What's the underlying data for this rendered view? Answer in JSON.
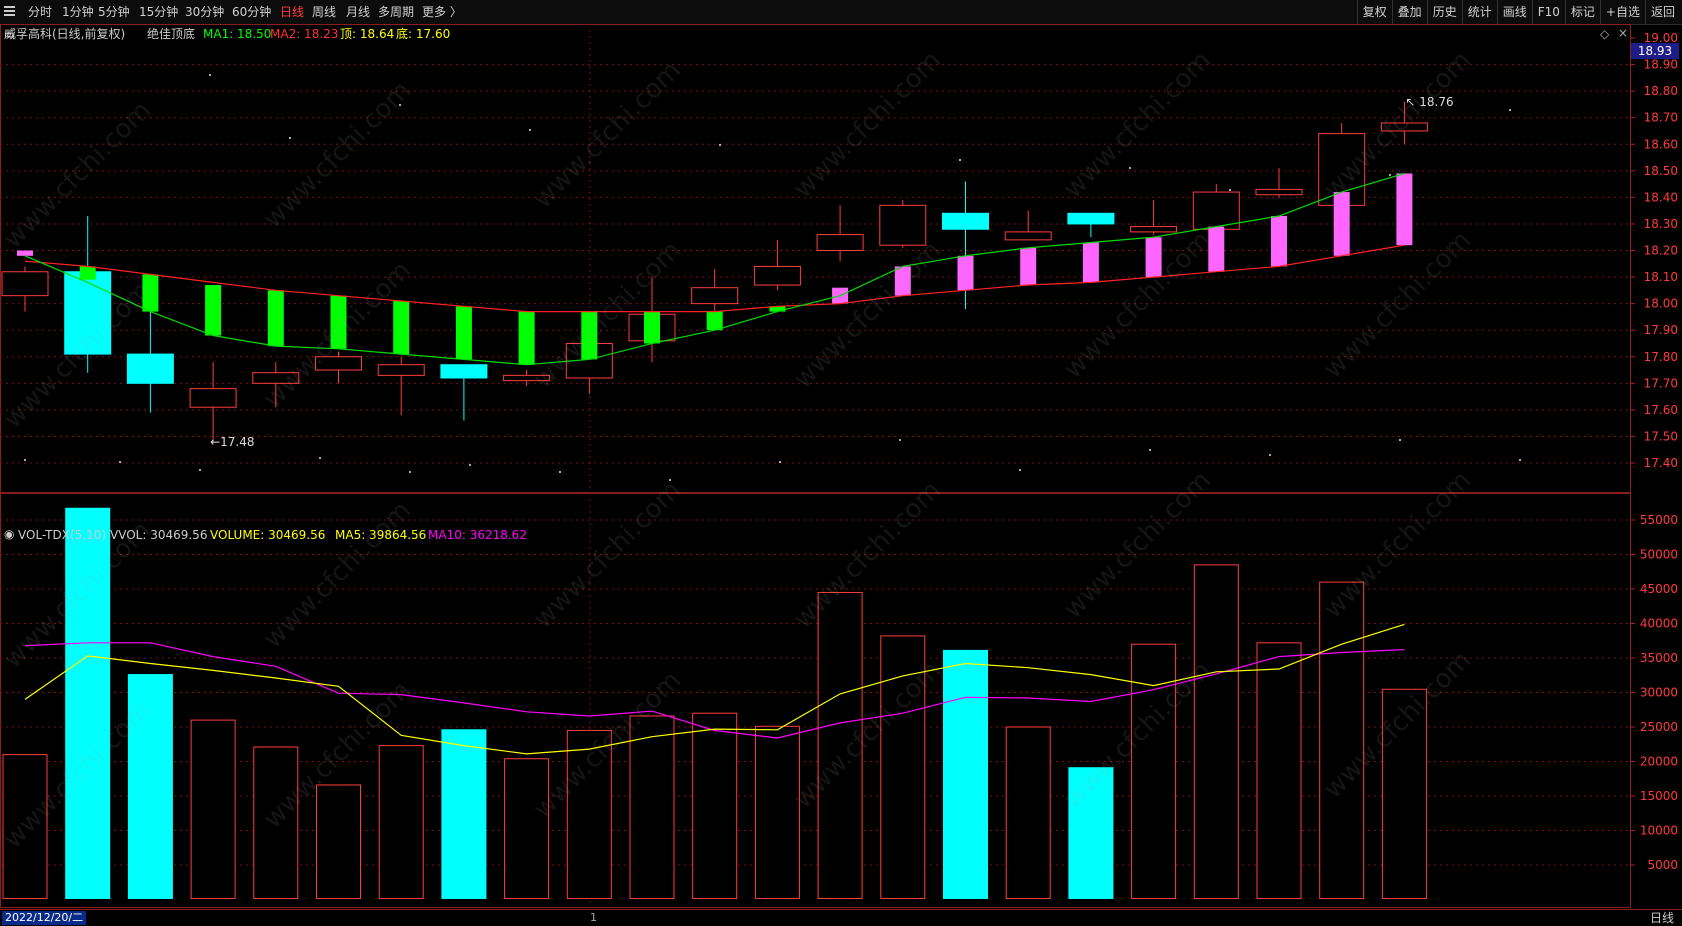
{
  "toolbar": {
    "periods": [
      "分时",
      "1分钟",
      "5分钟",
      "15分钟",
      "30分钟",
      "60分钟",
      "日线",
      "周线",
      "月线",
      "多周期",
      "更多 〉"
    ],
    "active_period": "日线",
    "right_buttons": [
      "复权",
      "叠加",
      "历史",
      "统计",
      "画线",
      "F10",
      "标记",
      "+自选",
      "返回"
    ]
  },
  "main_overlay": {
    "stock_name": "威孚高科(日线,前复权)",
    "indicator": "绝佳顶底",
    "ma1_label": "MA1: 18.50",
    "ma2_label": "MA2: 18.23",
    "top_label": "顶: 18.64",
    "bottom_label": "底: 17.60"
  },
  "vol_overlay": {
    "indicator": "VOL-TDX(5,10)",
    "vvol_label": "VVOL: 30469.56",
    "volume_label": "VOLUME: 30469.56",
    "ma5_label": "MA5: 39864.56",
    "ma10_label": "MA10: 36218.62"
  },
  "current_price_tag": "18.93",
  "high_annotation": "18.76",
  "low_annotation": "17.48",
  "bottom_bar": {
    "date": "2022/12/20/二",
    "mid_marker": "1",
    "period": "日线"
  },
  "watermark_text": "www.cfchi.com",
  "colors": {
    "up": "#ff3c3c",
    "up_fill_magenta": "#ff66ff",
    "down_cyan": "#00ffff",
    "down_green": "#00ff00",
    "ma_green": "#00dd00",
    "ma_red": "#ff2222",
    "vol_ma5": "#ffff00",
    "vol_ma10": "#ff00ff"
  },
  "chart_data": [
    {
      "type": "candlestick",
      "price_ticks": [
        "19.00",
        "18.90",
        "18.80",
        "18.70",
        "18.60",
        "18.50",
        "18.40",
        "18.30",
        "18.20",
        "18.10",
        "18.00",
        "17.90",
        "17.80",
        "17.70",
        "17.60",
        "17.50",
        "17.40"
      ],
      "ylim": [
        17.34,
        19.02
      ],
      "candles": [
        {
          "o": 18.03,
          "h": 18.14,
          "l": 17.97,
          "c": 18.12,
          "style": "up"
        },
        {
          "o": 18.12,
          "h": 18.33,
          "l": 17.74,
          "c": 17.81,
          "style": "cyan"
        },
        {
          "o": 17.81,
          "h": 17.98,
          "l": 17.59,
          "c": 17.7,
          "style": "cyan"
        },
        {
          "o": 17.61,
          "h": 17.78,
          "l": 17.48,
          "c": 17.68,
          "style": "up"
        },
        {
          "o": 17.7,
          "h": 17.78,
          "l": 17.61,
          "c": 17.74,
          "style": "up"
        },
        {
          "o": 17.75,
          "h": 17.82,
          "l": 17.7,
          "c": 17.8,
          "style": "up"
        },
        {
          "o": 17.73,
          "h": 17.8,
          "l": 17.58,
          "c": 17.77,
          "style": "up"
        },
        {
          "o": 17.77,
          "h": 17.77,
          "l": 17.56,
          "c": 17.72,
          "style": "cyan"
        },
        {
          "o": 17.71,
          "h": 17.75,
          "l": 17.69,
          "c": 17.73,
          "style": "up"
        },
        {
          "o": 17.72,
          "h": 17.79,
          "l": 17.66,
          "c": 17.85,
          "style": "up"
        },
        {
          "o": 17.86,
          "h": 18.1,
          "l": 17.78,
          "c": 17.96,
          "style": "up"
        },
        {
          "o": 18.0,
          "h": 18.13,
          "l": 17.97,
          "c": 18.06,
          "style": "up"
        },
        {
          "o": 18.07,
          "h": 18.24,
          "l": 18.05,
          "c": 18.14,
          "style": "up"
        },
        {
          "o": 18.2,
          "h": 18.37,
          "l": 18.16,
          "c": 18.26,
          "style": "up"
        },
        {
          "o": 18.22,
          "h": 18.39,
          "l": 18.21,
          "c": 18.37,
          "style": "up"
        },
        {
          "o": 18.34,
          "h": 18.46,
          "l": 17.98,
          "c": 18.28,
          "style": "cyan"
        },
        {
          "o": 18.24,
          "h": 18.35,
          "l": 18.24,
          "c": 18.27,
          "style": "up"
        },
        {
          "o": 18.34,
          "h": 18.34,
          "l": 18.25,
          "c": 18.3,
          "style": "cyan"
        },
        {
          "o": 18.27,
          "h": 18.39,
          "l": 18.26,
          "c": 18.29,
          "style": "up"
        },
        {
          "o": 18.28,
          "h": 18.45,
          "l": 18.28,
          "c": 18.42,
          "style": "up"
        },
        {
          "o": 18.41,
          "h": 18.51,
          "l": 18.4,
          "c": 18.43,
          "style": "up"
        },
        {
          "o": 18.37,
          "h": 18.68,
          "l": 18.36,
          "c": 18.64,
          "style": "up"
        },
        {
          "o": 18.65,
          "h": 18.76,
          "l": 18.6,
          "c": 18.68,
          "style": "up"
        }
      ],
      "signal_bars": [
        {
          "i": 0,
          "top": 18.2,
          "bot": 18.18,
          "color": "magenta"
        },
        {
          "i": 1,
          "top": 18.14,
          "bot": 18.09,
          "color": "green"
        },
        {
          "i": 2,
          "top": 18.11,
          "bot": 17.97,
          "color": "green"
        },
        {
          "i": 3,
          "top": 18.07,
          "bot": 17.88,
          "color": "green"
        },
        {
          "i": 4,
          "top": 18.05,
          "bot": 17.84,
          "color": "green"
        },
        {
          "i": 5,
          "top": 18.03,
          "bot": 17.83,
          "color": "green"
        },
        {
          "i": 6,
          "top": 18.01,
          "bot": 17.81,
          "color": "green"
        },
        {
          "i": 7,
          "top": 17.99,
          "bot": 17.79,
          "color": "green"
        },
        {
          "i": 8,
          "top": 17.97,
          "bot": 17.77,
          "color": "green"
        },
        {
          "i": 9,
          "top": 17.97,
          "bot": 17.79,
          "color": "green"
        },
        {
          "i": 10,
          "top": 17.97,
          "bot": 17.85,
          "color": "green"
        },
        {
          "i": 11,
          "top": 17.97,
          "bot": 17.9,
          "color": "green"
        },
        {
          "i": 12,
          "top": 17.99,
          "bot": 17.97,
          "color": "green"
        },
        {
          "i": 13,
          "top": 18.06,
          "bot": 18.0,
          "color": "magenta"
        },
        {
          "i": 14,
          "top": 18.14,
          "bot": 18.03,
          "color": "magenta"
        },
        {
          "i": 15,
          "top": 18.18,
          "bot": 18.05,
          "color": "magenta"
        },
        {
          "i": 16,
          "top": 18.21,
          "bot": 18.07,
          "color": "magenta"
        },
        {
          "i": 17,
          "top": 18.23,
          "bot": 18.08,
          "color": "magenta"
        },
        {
          "i": 18,
          "top": 18.25,
          "bot": 18.1,
          "color": "magenta"
        },
        {
          "i": 19,
          "top": 18.29,
          "bot": 18.12,
          "color": "magenta"
        },
        {
          "i": 20,
          "top": 18.33,
          "bot": 18.14,
          "color": "magenta"
        },
        {
          "i": 21,
          "top": 18.42,
          "bot": 18.18,
          "color": "magenta"
        },
        {
          "i": 22,
          "top": 18.49,
          "bot": 18.22,
          "color": "magenta"
        }
      ],
      "ma1": [
        18.18,
        18.08,
        17.97,
        17.88,
        17.84,
        17.83,
        17.81,
        17.79,
        17.77,
        17.79,
        17.85,
        17.9,
        17.97,
        18.03,
        18.14,
        18.18,
        18.21,
        18.23,
        18.25,
        18.29,
        18.33,
        18.42,
        18.49
      ],
      "ma2": [
        18.16,
        18.14,
        18.11,
        18.08,
        18.05,
        18.03,
        18.01,
        17.99,
        17.97,
        17.97,
        17.97,
        17.97,
        17.99,
        18.0,
        18.03,
        18.05,
        18.07,
        18.08,
        18.1,
        18.12,
        18.14,
        18.18,
        18.22
      ]
    },
    {
      "type": "bar",
      "vol_ticks": [
        "55000",
        "50000",
        "45000",
        "40000",
        "35000",
        "30000",
        "25000",
        "20000",
        "15000",
        "10000",
        "5000"
      ],
      "ylim": [
        0,
        57000
      ],
      "volumes": [
        21000,
        56700,
        32600,
        26000,
        22100,
        16600,
        22300,
        24600,
        20400,
        24500,
        26600,
        27000,
        25100,
        44500,
        38200,
        36100,
        25000,
        19100,
        37000,
        48500,
        37200,
        46000,
        30469.56
      ],
      "vol_styles": [
        "up",
        "cyan",
        "cyan",
        "up",
        "up",
        "up",
        "up",
        "cyan",
        "up",
        "up",
        "up",
        "up",
        "up",
        "up",
        "up",
        "cyan",
        "up",
        "cyan",
        "up",
        "up",
        "up",
        "up",
        "up"
      ],
      "ma5": [
        29000,
        35300,
        34200,
        33200,
        32100,
        30900,
        23800,
        22300,
        21100,
        21800,
        23600,
        24700,
        24600,
        29800,
        32400,
        34200,
        33600,
        32600,
        31000,
        33000,
        33400,
        37000,
        39864.56
      ],
      "ma10": [
        36800,
        37200,
        37200,
        35200,
        33800,
        29900,
        29700,
        28500,
        27200,
        26600,
        27300,
        24500,
        23400,
        25600,
        27000,
        29300,
        29200,
        28700,
        30400,
        32700,
        35200,
        35800,
        36218.62
      ]
    }
  ]
}
